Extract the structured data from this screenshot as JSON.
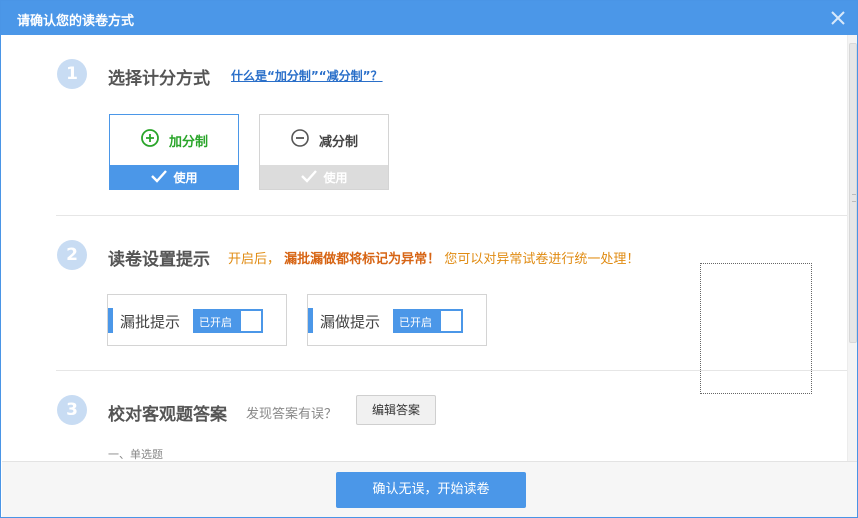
{
  "window": {
    "title": "请确认您的读卷方式",
    "close_icon": "close-icon"
  },
  "step1": {
    "number": "1",
    "title": "选择计分方式",
    "help_link": "什么是“加分制”“减分制”？",
    "options": [
      {
        "label": "加分制",
        "icon": "plus-circle-icon",
        "action": "使用",
        "state": "selected"
      },
      {
        "label": "减分制",
        "icon": "minus-circle-icon",
        "action": "使用",
        "state": "unselected"
      }
    ]
  },
  "step2": {
    "number": "2",
    "title": "读卷设置提示",
    "hint_prefix": "开启后，",
    "hint_emphasis": "漏批漏做都将标记为异常！",
    "hint_suffix": "您可以对异常试卷进行统一处理！",
    "toggles": [
      {
        "label": "漏批提示",
        "state_label": "已开启",
        "on": true
      },
      {
        "label": "漏做提示",
        "state_label": "已开启",
        "on": true
      }
    ]
  },
  "step3": {
    "number": "3",
    "title": "校对客观题答案",
    "question": "发现答案有误？",
    "edit_button": "编辑答案",
    "section_label": "一、单选题"
  },
  "footer": {
    "confirm_button": "确认无误，开始读卷"
  },
  "colors": {
    "accent": "#4b97e8",
    "step_badge": "#c8dcf3",
    "green": "#2aa52a",
    "hint_orange": "#e08b12",
    "hint_red": "#d76515"
  }
}
